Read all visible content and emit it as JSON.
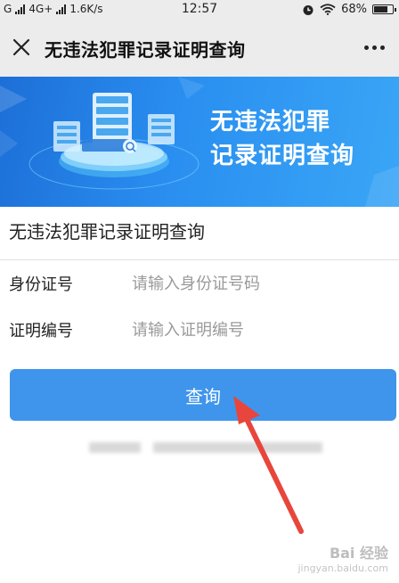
{
  "status_bar": {
    "carrier_1": "G",
    "network": "4G+",
    "speed": "1.6K/s",
    "time": "12:57",
    "battery": "68%"
  },
  "nav": {
    "title": "无违法犯罪记录证明查询",
    "close_icon": "close-icon",
    "more_icon": "more-icon"
  },
  "banner": {
    "line1": "无违法犯罪",
    "line2": "记录证明查询"
  },
  "page": {
    "heading": "无违法犯罪记录证明查询"
  },
  "form": {
    "id_label": "身份证号",
    "id_placeholder": "请输入身份证号码",
    "cert_label": "证明编号",
    "cert_placeholder": "请输入证明编号",
    "submit_label": "查询"
  },
  "watermark": {
    "main": "Bai 经验",
    "sub": "jingyan.baidu.com"
  },
  "colors": {
    "button": "#3f95ec",
    "banner_start": "#1d6fd8",
    "banner_end": "#3aa6f6",
    "arrow": "#e8463c"
  }
}
